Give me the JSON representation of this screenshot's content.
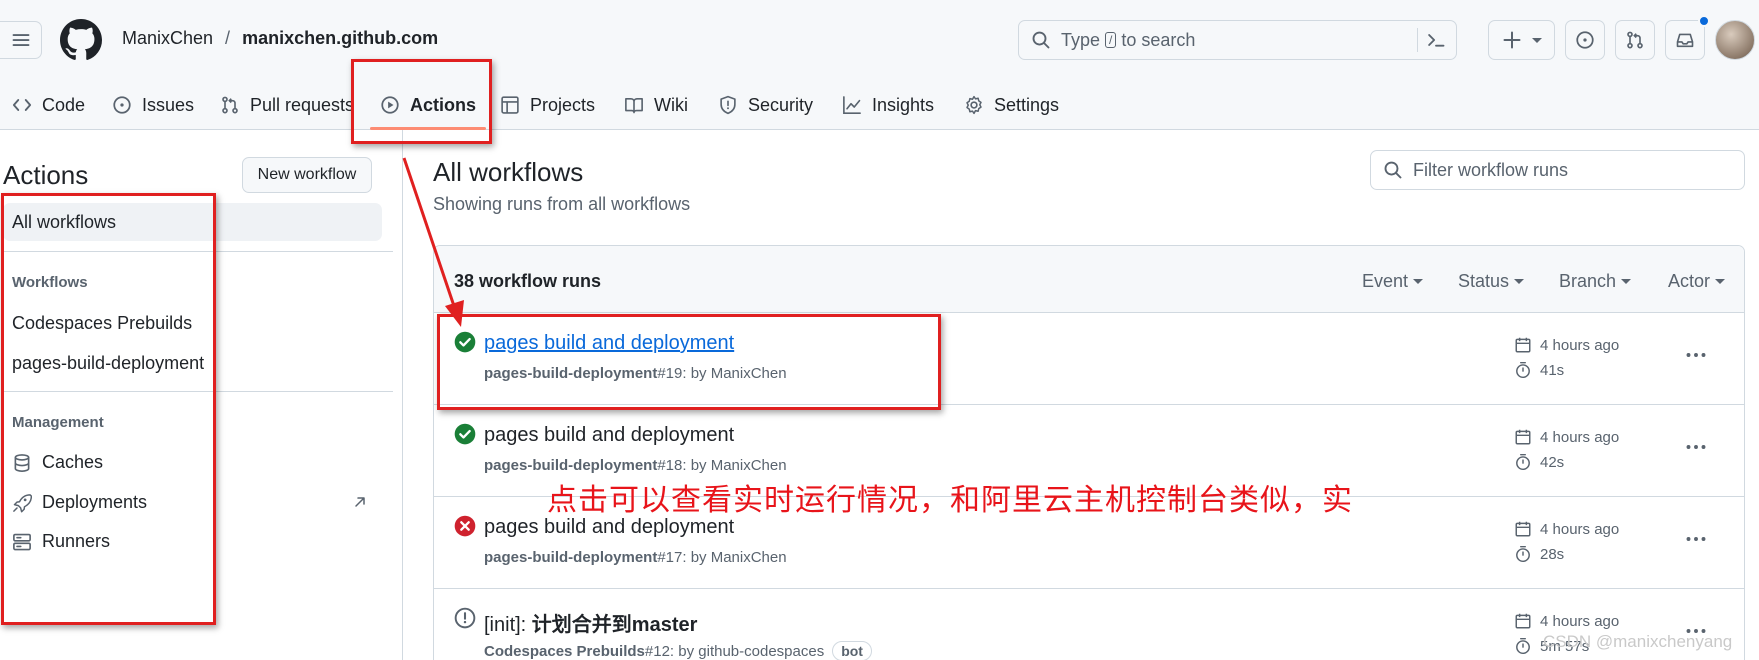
{
  "header": {
    "owner": "ManixChen",
    "separator": "/",
    "repo": "manixchen.github.com",
    "search_placeholder_pre": "Type",
    "search_key": "/",
    "search_placeholder_post": "to search"
  },
  "tabs": [
    {
      "label": "Code",
      "icon": "code-icon"
    },
    {
      "label": "Issues",
      "icon": "issue-icon"
    },
    {
      "label": "Pull requests",
      "icon": "pull-request-icon"
    },
    {
      "label": "Actions",
      "icon": "play-icon",
      "active": true
    },
    {
      "label": "Projects",
      "icon": "table-icon"
    },
    {
      "label": "Wiki",
      "icon": "book-icon"
    },
    {
      "label": "Security",
      "icon": "shield-icon"
    },
    {
      "label": "Insights",
      "icon": "graph-icon"
    },
    {
      "label": "Settings",
      "icon": "gear-icon"
    }
  ],
  "sidebar": {
    "title": "Actions",
    "new_workflow": "New workflow",
    "all_workflows": "All workflows",
    "workflows_heading": "Workflows",
    "workflows": [
      "Codespaces Prebuilds",
      "pages-build-deployment"
    ],
    "management_heading": "Management",
    "management": [
      {
        "label": "Caches",
        "icon": "database-icon"
      },
      {
        "label": "Deployments",
        "icon": "rocket-icon"
      },
      {
        "label": "Runners",
        "icon": "server-icon"
      }
    ]
  },
  "main": {
    "title": "All workflows",
    "subtitle": "Showing runs from all workflows",
    "filter_placeholder": "Filter workflow runs",
    "runs_count": "38 workflow runs",
    "filters": [
      "Event",
      "Status",
      "Branch",
      "Actor"
    ],
    "runs": [
      {
        "title": "pages build and deployment",
        "workflow": "pages-build-deployment",
        "meta": " #19: by ManixChen",
        "time": "4 hours ago",
        "duration": "41s",
        "status": "success",
        "link": true
      },
      {
        "title": "pages build and deployment",
        "workflow": "pages-build-deployment",
        "meta": " #18: by ManixChen",
        "time": "4 hours ago",
        "duration": "42s",
        "status": "success"
      },
      {
        "title": "pages build and deployment",
        "workflow": "pages-build-deployment",
        "meta": " #17: by ManixChen",
        "time": "4 hours ago",
        "duration": "28s",
        "status": "failure"
      },
      {
        "title_prefix": "[init]: ",
        "title_bold": "计划合并到master",
        "workflow": "Codespaces Prebuilds",
        "meta": " #12: by github-codespaces",
        "badge": "bot",
        "time": "4 hours ago",
        "duration": "5m 57s",
        "status": "neutral"
      }
    ]
  },
  "annotation": {
    "note": "点击可以查看实时运行情况，和阿里云主机控制台类似，实",
    "color": "#e02020"
  },
  "watermark": "CSDN @manixchenyang"
}
